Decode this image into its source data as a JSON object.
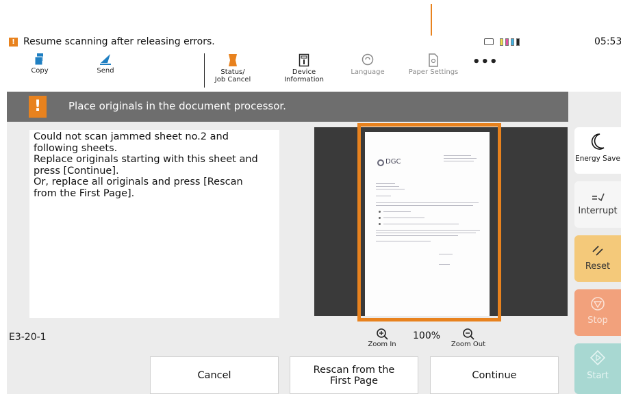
{
  "status_bar": {
    "message": "Resume scanning after releasing errors.",
    "clock": "05:53"
  },
  "toolbar": {
    "copy_label": "Copy",
    "send_label": "Send",
    "status_line1": "Status/",
    "status_line2": "Job Cancel",
    "device_line1": "Device",
    "device_line2": "Information",
    "language_label": "Language",
    "paper_settings_label": "Paper Settings",
    "more_label": "•••"
  },
  "banner": {
    "icon": "!",
    "message": "Place originals in the document processor."
  },
  "message_panel": {
    "text": "Could not scan jammed sheet no.2 and\nfollowing sheets.\nReplace originals starting with this sheet and\npress [Continue].\nOr, replace all originals and press [Rescan\nfrom the First Page]."
  },
  "preview": {
    "logo_text": "DGC"
  },
  "footer": {
    "error_code": "E3-20-1",
    "zoom_in_label": "Zoom In",
    "zoom_out_label": "Zoom Out",
    "zoom_level": "100%"
  },
  "actions": {
    "cancel_label": "Cancel",
    "rescan_label": "Rescan from the First Page",
    "continue_label": "Continue"
  },
  "side_keys": {
    "energy_saver_label": "Energy Save",
    "interrupt_label": "Interrupt",
    "reset_label": "Reset",
    "stop_label": "Stop",
    "start_label": "Start"
  },
  "colors": {
    "accent_orange": "#e8821e",
    "banner_gray": "#6e6e6e",
    "reset_key": "#f4c97a",
    "stop_key": "#f2a17c",
    "start_key": "#a8d8d2"
  }
}
